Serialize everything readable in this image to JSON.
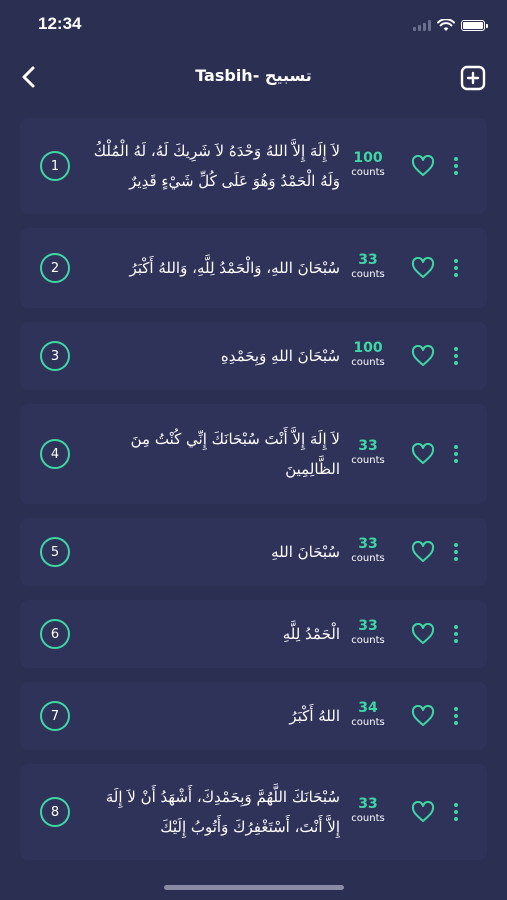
{
  "status": {
    "time": "12:34"
  },
  "header": {
    "title": "Tasbih- تسبيح"
  },
  "tasbih": {
    "count_label": "counts",
    "items": [
      {
        "number": "1",
        "text": "لاَ إِلَهَ إِلاَّ اللهُ وَحْدَهُ لاَ شَرِيكَ لَهُ، لَهُ الْمُلْكُ وَلَهُ الْحَمْدُ وَهُوَ عَلَى كُلِّ شَيْءٍ قَدِيرٌ",
        "count": "100"
      },
      {
        "number": "2",
        "text": "سُبْحَانَ اللهِ، وَالْحَمْدُ لِلَّهِ، وَاللهُ أَكْبَرُ",
        "count": "33"
      },
      {
        "number": "3",
        "text": "سُبْحَانَ اللهِ وَبِحَمْدِهِ",
        "count": "100"
      },
      {
        "number": "4",
        "text": "لاَ إِلَهَ إِلاَّ أَنْتَ سُبْحَانَكَ إِنِّي كُنْتُ مِنَ الظَّالِمِينَ",
        "count": "33"
      },
      {
        "number": "5",
        "text": "سُبْحَانَ اللهِ",
        "count": "33"
      },
      {
        "number": "6",
        "text": "الْحَمْدُ لِلَّهِ",
        "count": "33"
      },
      {
        "number": "7",
        "text": "اللهُ أَكْبَرُ",
        "count": "34"
      },
      {
        "number": "8",
        "text": "سُبْحَانَكَ اللَّهُمَّ وَبِحَمْدِكَ، أَشْهَدُ أَنْ لاَ إِلَهَ إِلاَّ أَنْتَ، أَسْتَغْفِرُكَ وَأَتُوبُ إِلَيْكَ",
        "count": "33"
      }
    ]
  },
  "colors": {
    "background": "#2b2f52",
    "card": "#2f335a",
    "accent": "#3fd6a5"
  },
  "icons": {
    "back": "chevron-left-icon",
    "add": "plus-square-icon",
    "favorite": "heart-outline-icon",
    "menu": "more-vertical-icon"
  }
}
